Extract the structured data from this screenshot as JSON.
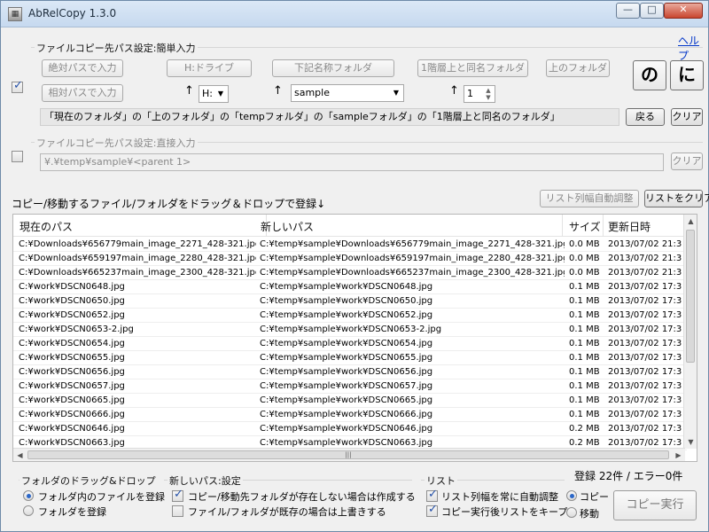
{
  "window": {
    "title": "AbRelCopy 1.3.0",
    "help_link": "ヘルプ",
    "minimize_icon": "minimize-icon",
    "maximize_icon": "maximize-icon",
    "close_icon": "close-icon"
  },
  "simple_input": {
    "group_label": "ファイルコピー先パス設定:簡単入力",
    "buttons": [
      "絶対パスで入力",
      "H:ドライブ",
      "下記名称フォルダ",
      "1階層上と同名フォルダ",
      "上のフォルダ",
      "相対パスで入力"
    ],
    "drive_value": "H:",
    "folder_name_value": "sample",
    "level_value": "1",
    "big_buttons": [
      "の",
      "に"
    ],
    "path_text": "「現在のフォルダ」の「上のフォルダ」の「tempフォルダ」の「sampleフォルダ」の「1階層上と同名のフォルダ」",
    "back_button": "戻る",
    "clear_button": "クリア",
    "checked": true
  },
  "direct_input": {
    "group_label": "ファイルコピー先パス設定:直接入力",
    "value": "¥.¥temp¥sample¥<parent 1>",
    "clear_button": "クリア",
    "checked": false
  },
  "list_section": {
    "hint": "コピー/移動するファイル/フォルダをドラッグ＆ドロップで登録↓",
    "auto_fit_button": "リスト列幅自動調整",
    "clear_list_button": "リストをクリア",
    "columns": [
      "現在のパス",
      "新しいパス",
      "サイズ",
      "更新日時"
    ],
    "rows": [
      [
        "C:¥Downloads¥656779main_image_2271_428-321.jpg",
        "C:¥temp¥sample¥Downloads¥656779main_image_2271_428-321.jpg",
        "0.0 MB",
        "2013/07/02 21:3"
      ],
      [
        "C:¥Downloads¥659197main_image_2280_428-321.jpg",
        "C:¥temp¥sample¥Downloads¥659197main_image_2280_428-321.jpg",
        "0.0 MB",
        "2013/07/02 21:3"
      ],
      [
        "C:¥Downloads¥665237main_image_2300_428-321.jpg",
        "C:¥temp¥sample¥Downloads¥665237main_image_2300_428-321.jpg",
        "0.0 MB",
        "2013/07/02 21:3"
      ],
      [
        "C:¥work¥DSCN0648.jpg",
        "C:¥temp¥sample¥work¥DSCN0648.jpg",
        "0.1 MB",
        "2013/07/02 17:3"
      ],
      [
        "C:¥work¥DSCN0650.jpg",
        "C:¥temp¥sample¥work¥DSCN0650.jpg",
        "0.1 MB",
        "2013/07/02 17:3"
      ],
      [
        "C:¥work¥DSCN0652.jpg",
        "C:¥temp¥sample¥work¥DSCN0652.jpg",
        "0.1 MB",
        "2013/07/02 17:3"
      ],
      [
        "C:¥work¥DSCN0653-2.jpg",
        "C:¥temp¥sample¥work¥DSCN0653-2.jpg",
        "0.1 MB",
        "2013/07/02 17:3"
      ],
      [
        "C:¥work¥DSCN0654.jpg",
        "C:¥temp¥sample¥work¥DSCN0654.jpg",
        "0.1 MB",
        "2013/07/02 17:3"
      ],
      [
        "C:¥work¥DSCN0655.jpg",
        "C:¥temp¥sample¥work¥DSCN0655.jpg",
        "0.1 MB",
        "2013/07/02 17:3"
      ],
      [
        "C:¥work¥DSCN0656.jpg",
        "C:¥temp¥sample¥work¥DSCN0656.jpg",
        "0.1 MB",
        "2013/07/02 17:3"
      ],
      [
        "C:¥work¥DSCN0657.jpg",
        "C:¥temp¥sample¥work¥DSCN0657.jpg",
        "0.1 MB",
        "2013/07/02 17:3"
      ],
      [
        "C:¥work¥DSCN0665.jpg",
        "C:¥temp¥sample¥work¥DSCN0665.jpg",
        "0.1 MB",
        "2013/07/02 17:3"
      ],
      [
        "C:¥work¥DSCN0666.jpg",
        "C:¥temp¥sample¥work¥DSCN0666.jpg",
        "0.1 MB",
        "2013/07/02 17:3"
      ],
      [
        "C:¥work¥DSCN0646.jpg",
        "C:¥temp¥sample¥work¥DSCN0646.jpg",
        "0.2 MB",
        "2013/07/02 17:3"
      ],
      [
        "C:¥work¥DSCN0663.jpg",
        "C:¥temp¥sample¥work¥DSCN0663.jpg",
        "0.2 MB",
        "2013/07/02 17:3"
      ]
    ]
  },
  "bottom": {
    "folder_dd_label": "フォルダのドラッグ&ドロップ",
    "folder_dd_options": [
      "フォルダ内のファイルを登録",
      "フォルダを登録"
    ],
    "new_path_label": "新しいパス:設定",
    "new_path_options": [
      "コピー/移動先フォルダが存在しない場合は作成する",
      "ファイル/フォルダが既存の場合は上書きする"
    ],
    "list_label": "リスト",
    "list_options": [
      "リスト列幅を常に自動調整",
      "コピー実行後リストをキープ"
    ],
    "mode_options": [
      "コピー",
      "移動"
    ],
    "status": "登録 22件 / エラー0件",
    "execute_button": "コピー実行"
  }
}
